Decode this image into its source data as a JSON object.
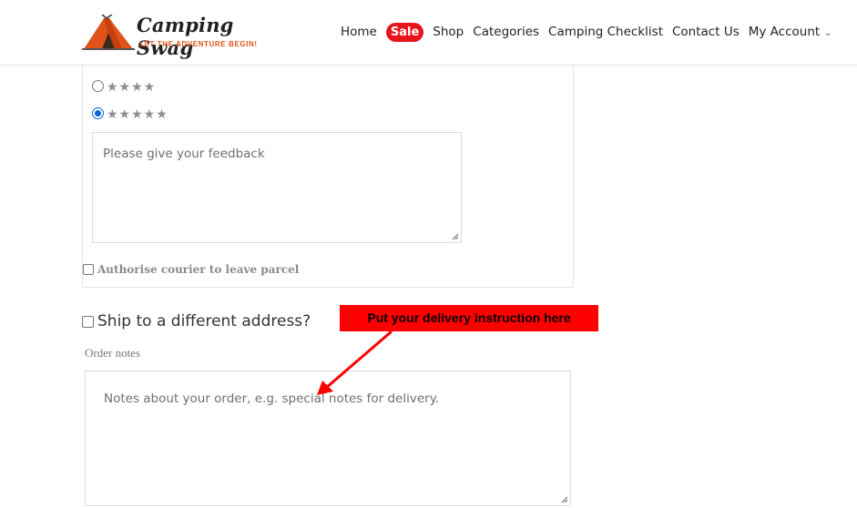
{
  "header": {
    "logo": {
      "title": "Camping Swag",
      "tagline": "LET THE ADVENTURE BEGIN!"
    },
    "nav": {
      "home": "Home",
      "sale": "Sale",
      "shop": "Shop",
      "categories": "Categories",
      "checklist": "Camping Checklist",
      "contact": "Contact Us",
      "account": "My Account"
    },
    "colors": {
      "sale_badge": "#e8141c",
      "logo_accent": "#e2531c"
    }
  },
  "feedback": {
    "rating_options": [
      {
        "stars": 4,
        "selected": false,
        "glyphs": "★★★★"
      },
      {
        "stars": 5,
        "selected": true,
        "glyphs": "★★★★★"
      }
    ],
    "textarea_placeholder": "Please give your feedback",
    "authorise_label": "Authorise courier to leave parcel",
    "authorise_checked": false
  },
  "shipping": {
    "different_address_label": "Ship to a different address?",
    "different_address_checked": false
  },
  "order_notes": {
    "label": "Order notes",
    "placeholder": "Notes about your order, e.g. special notes for delivery."
  },
  "annotation": {
    "text": "Put your delivery instruction here",
    "color": "#ff0000"
  }
}
